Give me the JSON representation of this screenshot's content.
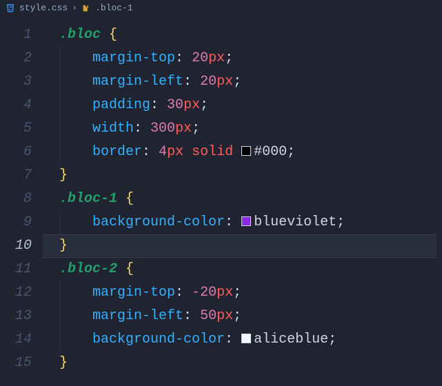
{
  "breadcrumbs": {
    "file": "style.css",
    "symbol": ".bloc-1"
  },
  "lines": [
    {
      "n": "1",
      "current": false,
      "indent": 0,
      "tokens": [
        {
          "t": "sel",
          "v": ".bloc"
        },
        {
          "t": "sp",
          "v": " "
        },
        {
          "t": "brace",
          "v": "{"
        }
      ]
    },
    {
      "n": "2",
      "current": false,
      "indent": 1,
      "tokens": [
        {
          "t": "prop",
          "v": "margin-top"
        },
        {
          "t": "punct",
          "v": ": "
        },
        {
          "t": "num",
          "v": "20"
        },
        {
          "t": "unit",
          "v": "px"
        },
        {
          "t": "punct",
          "v": ";"
        }
      ]
    },
    {
      "n": "3",
      "current": false,
      "indent": 1,
      "tokens": [
        {
          "t": "prop",
          "v": "margin-left"
        },
        {
          "t": "punct",
          "v": ": "
        },
        {
          "t": "num",
          "v": "20"
        },
        {
          "t": "unit",
          "v": "px"
        },
        {
          "t": "punct",
          "v": ";"
        }
      ]
    },
    {
      "n": "4",
      "current": false,
      "indent": 1,
      "tokens": [
        {
          "t": "prop",
          "v": "padding"
        },
        {
          "t": "punct",
          "v": ": "
        },
        {
          "t": "num",
          "v": "30"
        },
        {
          "t": "unit",
          "v": "px"
        },
        {
          "t": "punct",
          "v": ";"
        }
      ]
    },
    {
      "n": "5",
      "current": false,
      "indent": 1,
      "tokens": [
        {
          "t": "prop",
          "v": "width"
        },
        {
          "t": "punct",
          "v": ": "
        },
        {
          "t": "num",
          "v": "300"
        },
        {
          "t": "unit",
          "v": "px"
        },
        {
          "t": "punct",
          "v": ";"
        }
      ]
    },
    {
      "n": "6",
      "current": false,
      "indent": 1,
      "tokens": [
        {
          "t": "prop",
          "v": "border"
        },
        {
          "t": "punct",
          "v": ": "
        },
        {
          "t": "num",
          "v": "4"
        },
        {
          "t": "unit",
          "v": "px"
        },
        {
          "t": "sp",
          "v": " "
        },
        {
          "t": "ident",
          "v": "solid"
        },
        {
          "t": "sp",
          "v": " "
        },
        {
          "t": "swatch",
          "v": "#000000"
        },
        {
          "t": "color",
          "v": "#000"
        },
        {
          "t": "punct",
          "v": ";"
        }
      ]
    },
    {
      "n": "7",
      "current": false,
      "indent": 0,
      "tokens": [
        {
          "t": "brace",
          "v": "}"
        }
      ]
    },
    {
      "n": "8",
      "current": false,
      "indent": 0,
      "tokens": [
        {
          "t": "sel",
          "v": ".bloc-1"
        },
        {
          "t": "sp",
          "v": " "
        },
        {
          "t": "brace",
          "v": "{"
        }
      ]
    },
    {
      "n": "9",
      "current": false,
      "indent": 1,
      "tokens": [
        {
          "t": "prop",
          "v": "background-color"
        },
        {
          "t": "punct",
          "v": ": "
        },
        {
          "t": "swatch",
          "v": "#8a2be2"
        },
        {
          "t": "color",
          "v": "blueviolet"
        },
        {
          "t": "punct",
          "v": ";"
        }
      ]
    },
    {
      "n": "10",
      "current": true,
      "indent": 0,
      "tokens": [
        {
          "t": "brace",
          "v": "}"
        }
      ]
    },
    {
      "n": "11",
      "current": false,
      "indent": 0,
      "tokens": [
        {
          "t": "sel",
          "v": ".bloc-2"
        },
        {
          "t": "sp",
          "v": " "
        },
        {
          "t": "brace",
          "v": "{"
        }
      ]
    },
    {
      "n": "12",
      "current": false,
      "indent": 1,
      "tokens": [
        {
          "t": "prop",
          "v": "margin-top"
        },
        {
          "t": "punct",
          "v": ": "
        },
        {
          "t": "num",
          "v": "-20"
        },
        {
          "t": "unit",
          "v": "px"
        },
        {
          "t": "punct",
          "v": ";"
        }
      ]
    },
    {
      "n": "13",
      "current": false,
      "indent": 1,
      "tokens": [
        {
          "t": "prop",
          "v": "margin-left"
        },
        {
          "t": "punct",
          "v": ": "
        },
        {
          "t": "num",
          "v": "50"
        },
        {
          "t": "unit",
          "v": "px"
        },
        {
          "t": "punct",
          "v": ";"
        }
      ]
    },
    {
      "n": "14",
      "current": false,
      "indent": 1,
      "tokens": [
        {
          "t": "prop",
          "v": "background-color"
        },
        {
          "t": "punct",
          "v": ": "
        },
        {
          "t": "swatch",
          "v": "#f0f8ff"
        },
        {
          "t": "color",
          "v": "aliceblue"
        },
        {
          "t": "punct",
          "v": ";"
        }
      ]
    },
    {
      "n": "15",
      "current": false,
      "indent": 0,
      "tokens": [
        {
          "t": "brace",
          "v": "}"
        }
      ]
    }
  ]
}
